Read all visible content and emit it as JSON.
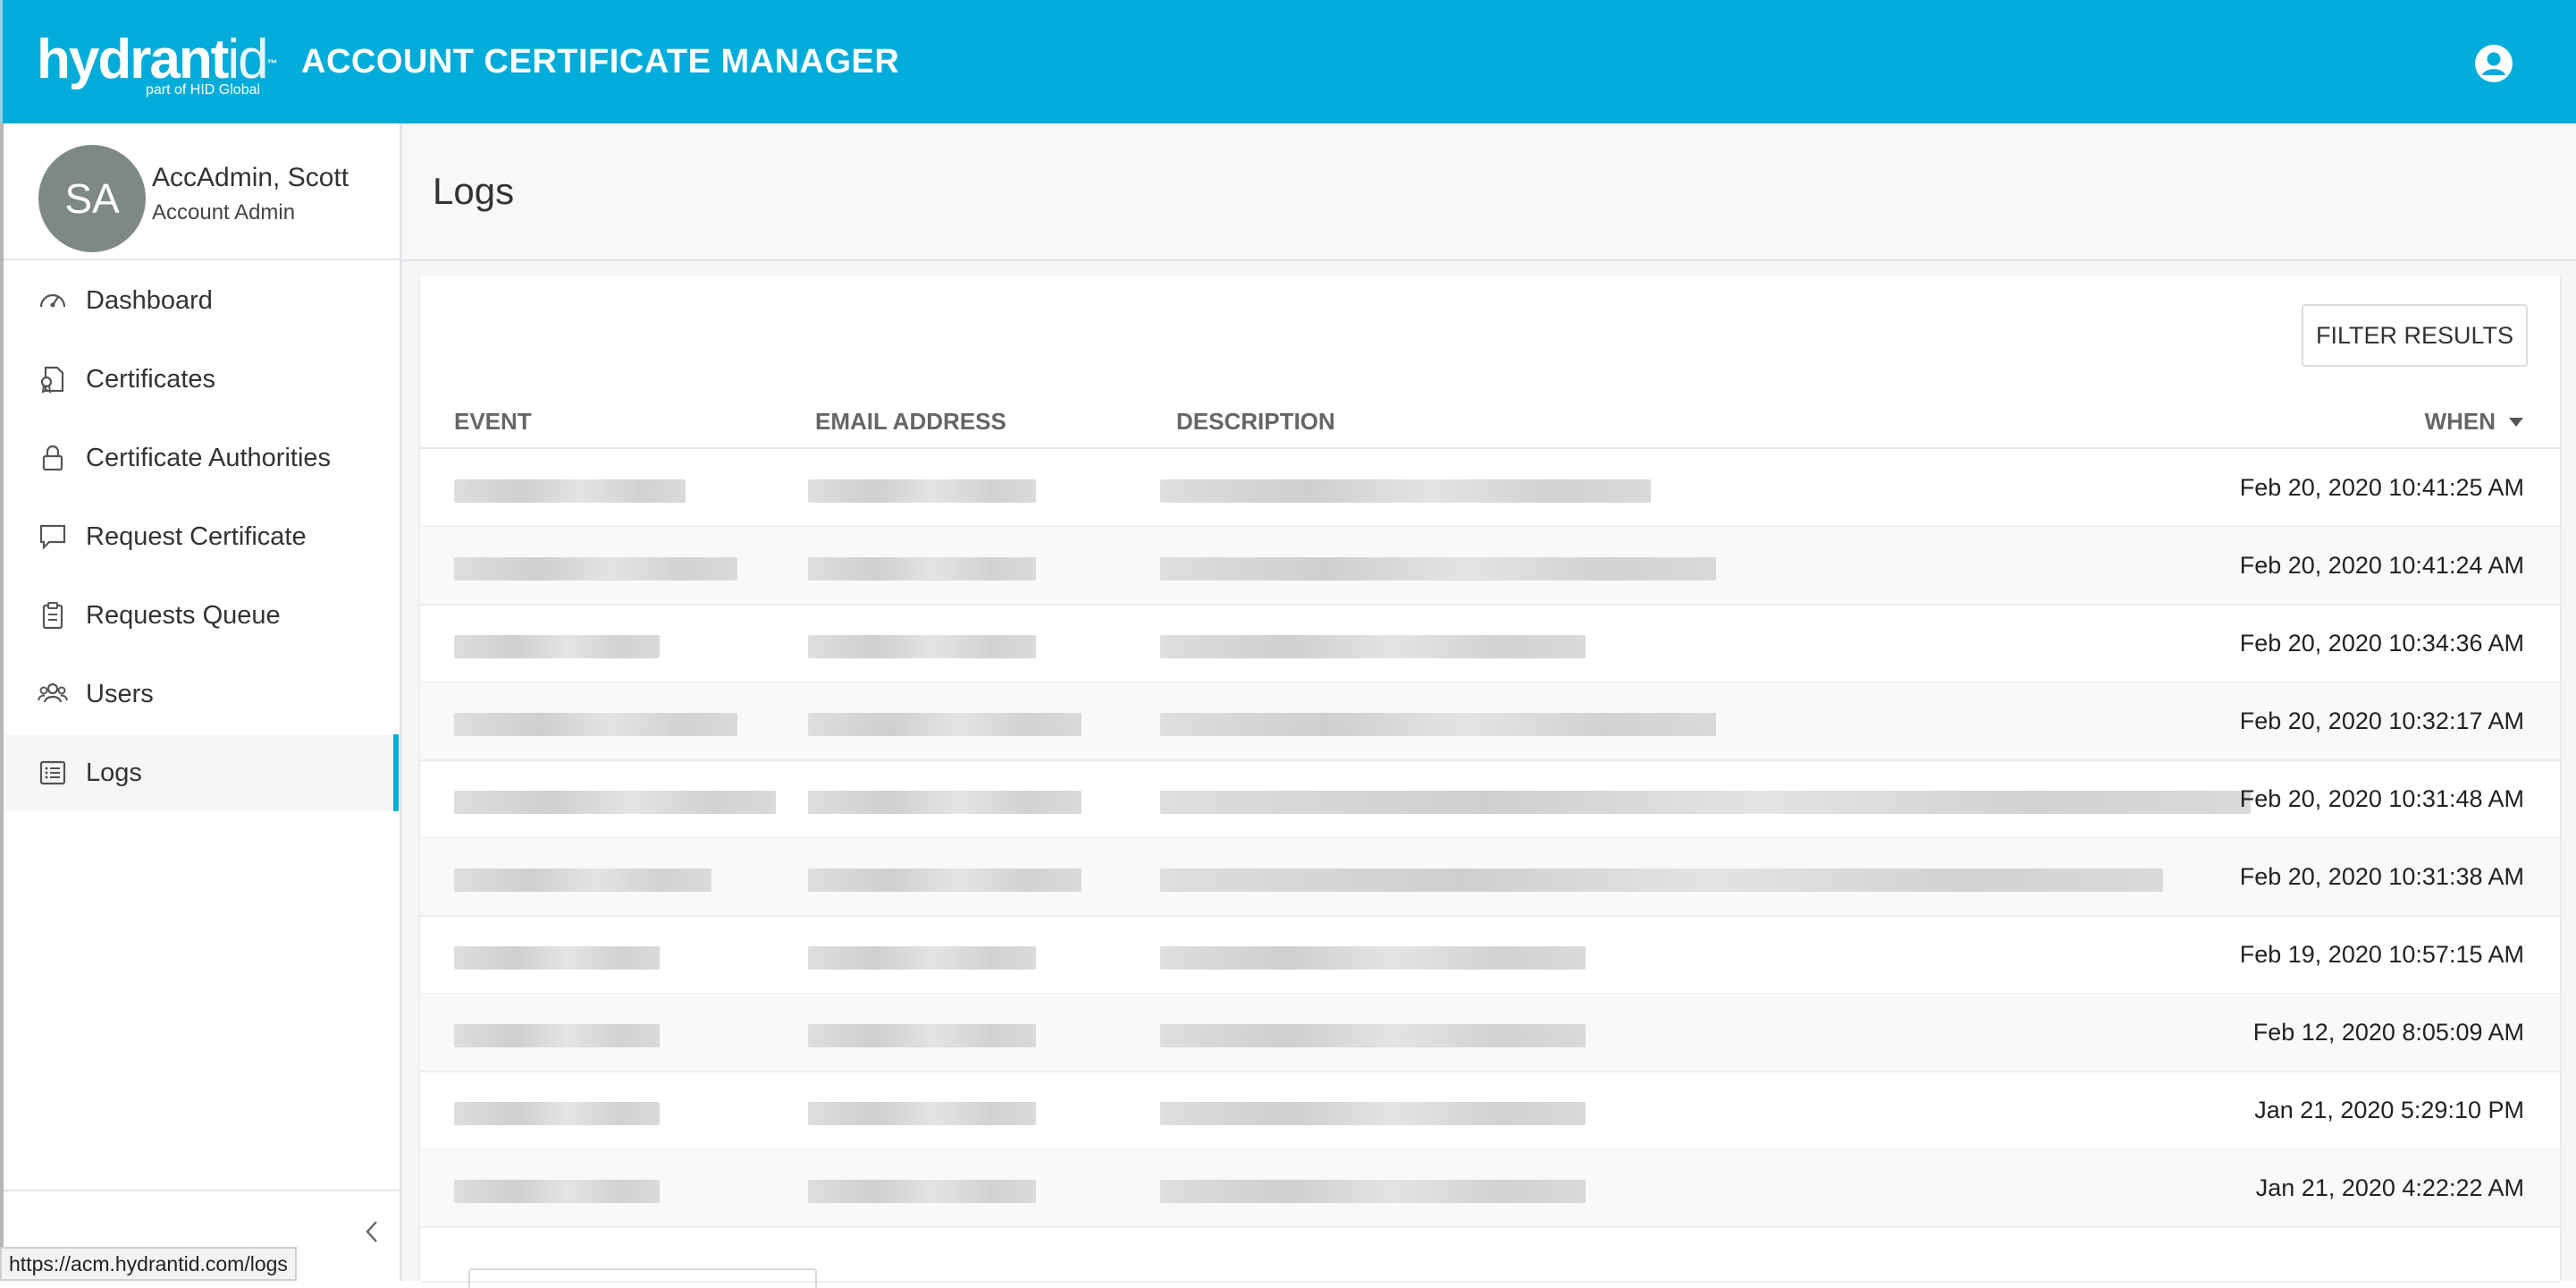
{
  "header": {
    "logo_text": "hydrant",
    "logo_id": "id",
    "logo_tm": "™",
    "logo_sub": "part of HID Global",
    "app_title": "ACCOUNT CERTIFICATE MANAGER",
    "user_icon": "user-circle-icon"
  },
  "profile": {
    "initials": "SA",
    "name": "AccAdmin, Scott",
    "role": "Account Admin"
  },
  "nav": [
    {
      "label": "Dashboard",
      "icon": "speedometer-icon",
      "active": false
    },
    {
      "label": "Certificates",
      "icon": "certificate-icon",
      "active": false
    },
    {
      "label": "Certificate Authorities",
      "icon": "lock-icon",
      "active": false
    },
    {
      "label": "Request Certificate",
      "icon": "chat-bubble-icon",
      "active": false
    },
    {
      "label": "Requests Queue",
      "icon": "clipboard-icon",
      "active": false
    },
    {
      "label": "Users",
      "icon": "users-icon",
      "active": false
    },
    {
      "label": "Logs",
      "icon": "list-icon",
      "active": true
    }
  ],
  "status_url": "https://acm.hydrantid.com/logs",
  "page": {
    "title": "Logs",
    "filter_label": "FILTER RESULTS"
  },
  "table": {
    "columns": [
      "EVENT",
      "EMAIL ADDRESS",
      "DESCRIPTION",
      "WHEN"
    ],
    "sort_column": "WHEN",
    "sort_direction": "desc",
    "rows": [
      {
        "when": "Feb 20, 2020 10:41:25 AM",
        "event_w": 0.72,
        "email_w": 0.75,
        "desc_w": 0.45
      },
      {
        "when": "Feb 20, 2020 10:41:24 AM",
        "event_w": 0.88,
        "email_w": 0.75,
        "desc_w": 0.51
      },
      {
        "when": "Feb 20, 2020 10:34:36 AM",
        "event_w": 0.64,
        "email_w": 0.75,
        "desc_w": 0.39
      },
      {
        "when": "Feb 20, 2020 10:32:17 AM",
        "event_w": 0.88,
        "email_w": 0.9,
        "desc_w": 0.51
      },
      {
        "when": "Feb 20, 2020 10:31:48 AM",
        "event_w": 1.0,
        "email_w": 0.9,
        "desc_w": 1.0
      },
      {
        "when": "Feb 20, 2020 10:31:38 AM",
        "event_w": 0.8,
        "email_w": 0.9,
        "desc_w": 0.92
      },
      {
        "when": "Feb 19, 2020 10:57:15 AM",
        "event_w": 0.64,
        "email_w": 0.75,
        "desc_w": 0.39
      },
      {
        "when": "Feb 12, 2020 8:05:09 AM",
        "event_w": 0.64,
        "email_w": 0.75,
        "desc_w": 0.39
      },
      {
        "when": "Jan 21, 2020 5:29:10 PM",
        "event_w": 0.64,
        "email_w": 0.75,
        "desc_w": 0.39
      },
      {
        "when": "Jan 21, 2020 4:22:22 AM",
        "event_w": 0.64,
        "email_w": 0.75,
        "desc_w": 0.39
      }
    ]
  },
  "colors": {
    "brand": "#00acd9",
    "avatar": "#7e8987",
    "active_bar": "#00acd9"
  }
}
